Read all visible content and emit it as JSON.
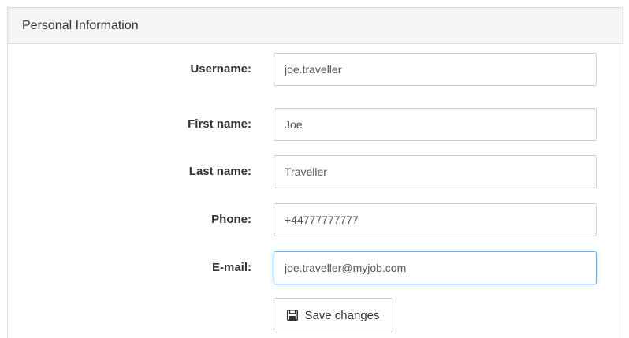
{
  "panel": {
    "title": "Personal Information"
  },
  "form": {
    "username": {
      "label": "Username:",
      "value": "joe.traveller"
    },
    "first_name": {
      "label": "First name:",
      "value": "Joe"
    },
    "last_name": {
      "label": "Last name:",
      "value": "Traveller"
    },
    "phone": {
      "label": "Phone:",
      "value": "+44777777777"
    },
    "email": {
      "label": "E-mail:",
      "value": "joe.traveller@myjob.com"
    }
  },
  "actions": {
    "save_label": "Save changes",
    "save_icon": "floppy-disk-icon"
  },
  "colors": {
    "heading_bg": "#f5f5f5",
    "border": "#cccccc",
    "focus_border": "#66afe9",
    "text": "#333333"
  }
}
